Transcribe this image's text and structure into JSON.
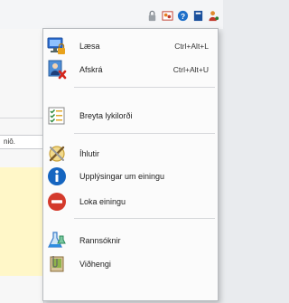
{
  "background": {
    "field_text": "niô.",
    "toolbar_icons": [
      "lock-icon",
      "user-group-icon",
      "help-circle-icon",
      "book-icon",
      "user-settings-icon"
    ]
  },
  "menu": {
    "items": [
      {
        "label": "Læsa",
        "shortcut": "Ctrl+Alt+L",
        "icon": "monitor-lock-icon"
      },
      {
        "label": "Afskrá",
        "shortcut": "Ctrl+Alt+U",
        "icon": "user-logout-icon"
      },
      {
        "label": "Breyta lykilorði",
        "shortcut": "",
        "icon": "password-form-icon"
      },
      {
        "label": "Íhlutir",
        "shortcut": "",
        "icon": "component-tools-icon"
      },
      {
        "label": "Upplýsingar um einingu",
        "shortcut": "",
        "icon": "info-circle-icon"
      },
      {
        "label": "Loka einingu",
        "shortcut": "",
        "icon": "stop-circle-icon"
      },
      {
        "label": "Rannsóknir",
        "shortcut": "",
        "icon": "flask-icon"
      },
      {
        "label": "Viðhengi",
        "shortcut": "",
        "icon": "attachment-icon"
      }
    ]
  },
  "colors": {
    "info_blue": "#1565c0",
    "stop_red": "#d43a2c",
    "menu_bg": "#fbfbfb"
  }
}
